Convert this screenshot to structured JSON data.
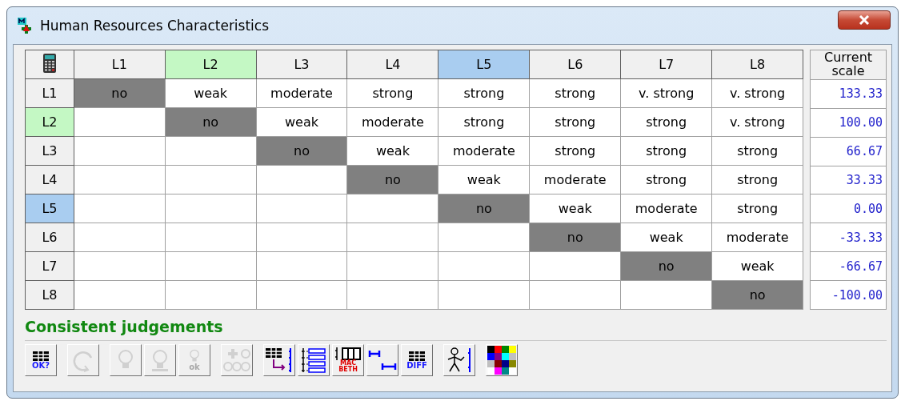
{
  "window": {
    "title": "Human Resources Characteristics"
  },
  "matrix": {
    "columns": [
      {
        "label": "L1"
      },
      {
        "label": "L2",
        "color": "#c4f8c4"
      },
      {
        "label": "L3"
      },
      {
        "label": "L4"
      },
      {
        "label": "L5",
        "color": "#a9cdf0"
      },
      {
        "label": "L6"
      },
      {
        "label": "L7"
      },
      {
        "label": "L8"
      }
    ],
    "scale_header": "Current scale",
    "rows": [
      {
        "label": "L1",
        "cells": [
          "no",
          "weak",
          "moderate",
          "strong",
          "strong",
          "strong",
          "v. strong",
          "v. strong"
        ],
        "scale": "133.33"
      },
      {
        "label": "L2",
        "color": "#c4f8c4",
        "cells": [
          "",
          "no",
          "weak",
          "moderate",
          "strong",
          "strong",
          "strong",
          "v. strong"
        ],
        "scale": "100.00"
      },
      {
        "label": "L3",
        "cells": [
          "",
          "",
          "no",
          "weak",
          "moderate",
          "strong",
          "strong",
          "strong"
        ],
        "scale": "66.67"
      },
      {
        "label": "L4",
        "cells": [
          "",
          "",
          "",
          "no",
          "weak",
          "moderate",
          "strong",
          "strong"
        ],
        "scale": "33.33"
      },
      {
        "label": "L5",
        "color": "#a9cdf0",
        "cells": [
          "",
          "",
          "",
          "",
          "no",
          "weak",
          "moderate",
          "strong"
        ],
        "scale": "0.00"
      },
      {
        "label": "L6",
        "cells": [
          "",
          "",
          "",
          "",
          "",
          "no",
          "weak",
          "moderate"
        ],
        "scale": "-33.33"
      },
      {
        "label": "L7",
        "cells": [
          "",
          "",
          "",
          "",
          "",
          "",
          "no",
          "weak"
        ],
        "scale": "-66.67"
      },
      {
        "label": "L8",
        "cells": [
          "",
          "",
          "",
          "",
          "",
          "",
          "",
          "no"
        ],
        "scale": "-100.00"
      }
    ]
  },
  "status": "Consistent judgements",
  "toolbar": [
    {
      "buttons": [
        {
          "kind": "grid-check",
          "label": "OK?",
          "disabled": false
        }
      ]
    },
    {
      "buttons": [
        {
          "kind": "cycle",
          "disabled": true
        }
      ]
    },
    {
      "buttons": [
        {
          "kind": "bulb",
          "disabled": true
        },
        {
          "kind": "bulb-arrow",
          "disabled": true
        },
        {
          "kind": "bulb-ok",
          "label": "ok",
          "disabled": true
        }
      ]
    },
    {
      "buttons": [
        {
          "kind": "bulb-group",
          "disabled": true
        }
      ]
    },
    {
      "buttons": [
        {
          "kind": "grid-scale",
          "disabled": false
        },
        {
          "kind": "tree",
          "disabled": false
        },
        {
          "kind": "macbeth",
          "label": "MAC BETH",
          "disabled": false
        },
        {
          "kind": "intervals",
          "disabled": false
        },
        {
          "kind": "diff",
          "label": "DIFF",
          "disabled": false
        }
      ]
    },
    {
      "buttons": [
        {
          "kind": "figure",
          "disabled": false
        }
      ]
    },
    {
      "buttons": [
        {
          "kind": "palette",
          "disabled": false
        }
      ]
    }
  ]
}
